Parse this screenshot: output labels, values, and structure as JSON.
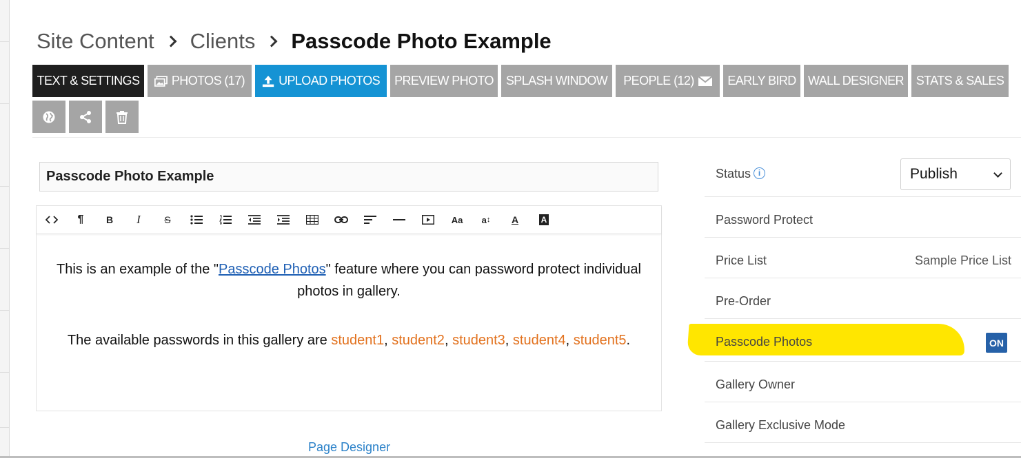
{
  "breadcrumb": {
    "items": [
      "Site Content",
      "Clients"
    ],
    "current": "Passcode Photo Example"
  },
  "tabs": [
    {
      "label": "TEXT & SETTINGS",
      "active": true
    },
    {
      "label": "PHOTOS (17)",
      "icon": "photos-icon"
    },
    {
      "label": "UPLOAD PHOTOS",
      "icon": "upload-icon",
      "highlighted": true
    },
    {
      "label": "PREVIEW PHOTO"
    },
    {
      "label": "SPLASH WINDOW"
    },
    {
      "label": "PEOPLE (12)",
      "icon": "envelope-icon"
    },
    {
      "label": "EARLY BIRD"
    },
    {
      "label": "WALL DESIGNER"
    },
    {
      "label": "STATS & SALES"
    }
  ],
  "icon_buttons": [
    "globe-icon",
    "share-icon",
    "trash-icon"
  ],
  "title_input": {
    "value": "Passcode Photo Example"
  },
  "editor": {
    "toolbar": [
      "code-view-icon",
      "paragraph-icon",
      "bold-icon",
      "italic-icon",
      "strikethrough-icon",
      "bullet-list-icon",
      "numbered-list-icon",
      "outdent-icon",
      "indent-icon",
      "table-icon",
      "link-icon",
      "align-icon",
      "horizontal-rule-icon",
      "video-icon",
      "font-size-icon",
      "line-height-icon",
      "text-color-icon",
      "background-color-icon"
    ],
    "toolbar_labels": {
      "paragraph": "¶",
      "bold": "B",
      "italic": "I",
      "strike": "S",
      "fontsize": "Aa",
      "lineheight": "a",
      "textcolor": "A",
      "bgcolor": "A"
    },
    "p1_before": "This is an example of the \"",
    "p1_link": "Passcode Photos",
    "p1_after": "\" feature where you can password protect individual photos in gallery.",
    "p2_before": "The available passwords in this gallery are ",
    "passwords": [
      "student1",
      "student2",
      "student3",
      "student4",
      "student5"
    ],
    "p2_comma": ", ",
    "p2_end": "."
  },
  "page_designer_link": "Page Designer",
  "settings": {
    "status_label": "Status",
    "status_info_icon": "i",
    "status_value": "Publish",
    "password_protect": "Password Protect",
    "price_list_label": "Price List",
    "price_list_value": "Sample Price List",
    "pre_order": "Pre-Order",
    "passcode_photos": "Passcode Photos",
    "passcode_toggle": "ON",
    "gallery_owner": "Gallery Owner",
    "gallery_exclusive_mode": "Gallery Exclusive Mode"
  },
  "colors": {
    "tab_gray": "#a5a5a5",
    "tab_active": "#1f1f1f",
    "tab_upload": "#1593d4",
    "password_orange": "#e2711d",
    "link_blue": "#1e5fb4",
    "toggle_blue": "#2661a8",
    "highlight_yellow": "#ffe600"
  }
}
